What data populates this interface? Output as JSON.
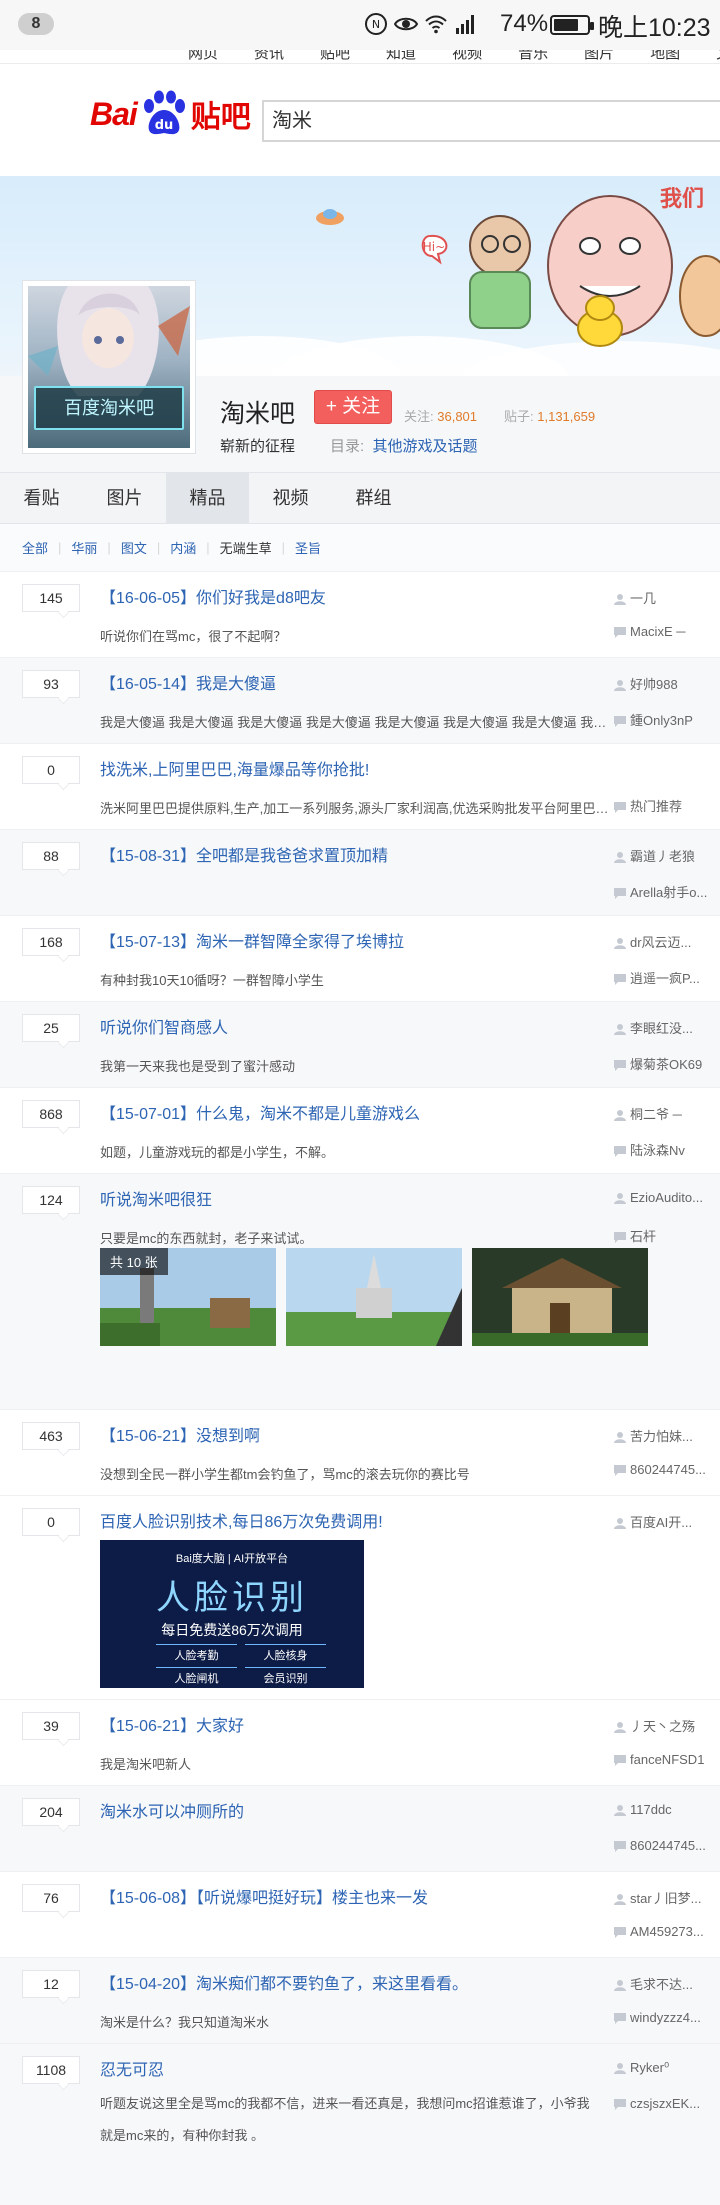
{
  "status_bar": {
    "notification_count": "8",
    "battery_pct": "74%",
    "battery_level": 0.74,
    "time": "晚上10:23",
    "icons": [
      "nfc-icon",
      "eye-icon",
      "wifi-icon",
      "signal-4g-icon",
      "battery-icon"
    ]
  },
  "top_nav": {
    "items": [
      "网页",
      "资讯",
      "贴吧",
      "知道",
      "视频",
      "音乐",
      "图片",
      "地图",
      "文库"
    ]
  },
  "header": {
    "logo_bai": "Bai",
    "logo_du": "du",
    "logo_tieba": "贴吧",
    "search_value": "淘米"
  },
  "forum": {
    "avatar_text": "百度淘米吧",
    "name": "淘米吧",
    "follow_label": "+ 关注",
    "follow_count_label": "关注:",
    "follow_count": "36,801",
    "post_count_label": "贴子:",
    "post_count": "1,131,659",
    "slogan": "崭新的征程",
    "catalog_label": "目录:",
    "catalog_link": "其他游戏及话题"
  },
  "tabs": [
    {
      "label": "看贴"
    },
    {
      "label": "图片"
    },
    {
      "label": "精品"
    },
    {
      "label": "视频"
    },
    {
      "label": "群组"
    }
  ],
  "filters": [
    {
      "label": "全部"
    },
    {
      "label": "华丽"
    },
    {
      "label": "图文"
    },
    {
      "label": "内涵"
    },
    {
      "label": "无端生草"
    },
    {
      "label": "圣旨"
    }
  ],
  "threads": [
    {
      "replies": "145",
      "title": "【16-06-05】你们好我是d8吧友",
      "abstract": "听说你们在骂mc，很了不起啊？",
      "author": "一几",
      "last_reply": "MacixE ─"
    },
    {
      "replies": "93",
      "title": "【16-05-14】我是大傻逼",
      "abstract": "我是大傻逼 我是大傻逼 我是大傻逼 我是大傻逼 我是大傻逼 我是大傻逼 我是大傻逼 我是大傻逼 我是大傻逼 我是大傻逼",
      "author": "好帅988",
      "last_reply": "鍾Only3nP"
    },
    {
      "replies": "0",
      "title": "找洗米,上阿里巴巴,海量爆品等你抢批!",
      "abstract": "洗米阿里巴巴提供原料,生产,加工一系列服务,源头厂家利润高,优选采购批发平台阿里巴巴,一站式采购",
      "author": "",
      "last_reply": "热门推荐"
    },
    {
      "replies": "88",
      "title": "【15-08-31】全吧都是我爸爸求置顶加精",
      "abstract": "",
      "author": "霸道丿老狼",
      "last_reply": "Arella射手o..."
    },
    {
      "replies": "168",
      "title": "【15-07-13】淘米一群智障全家得了埃博拉",
      "abstract": "有种封我10天10循呀？一群智障小学生",
      "author": "dr风云迈...",
      "last_reply": "逍遥一疯P..."
    },
    {
      "replies": "25",
      "title": "听说你们智商感人",
      "abstract": "我第一天来我也是受到了蜜汁感动",
      "author": "李眼红没...",
      "last_reply": "爆菊茶OK69"
    },
    {
      "replies": "868",
      "title": "【15-07-01】什么鬼，淘米不都是儿童游戏么",
      "abstract": "如题，儿童游戏玩的都是小学生，不解。",
      "author": "桐二爷 ─",
      "last_reply": "陆泳森Nv"
    },
    {
      "replies": "124",
      "title": "听说淘米吧很狂",
      "abstract": "只要是mc的东西就封，老子来试试。",
      "author": "EzioAudito...",
      "last_reply": "石杆",
      "image_count": "共 10 张"
    },
    {
      "replies": "463",
      "title": "【15-06-21】没想到啊",
      "abstract": "没想到全民一群小学生都tm会钓鱼了，骂mc的滚去玩你的赛比号",
      "author": "苦力怕妹...",
      "last_reply": "860244745..."
    },
    {
      "replies": "0",
      "title": "百度人脸识别技术,每日86万次免费调用!",
      "abstract": "",
      "author": "百度AI开...",
      "last_reply": ""
    },
    {
      "replies": "39",
      "title": "【15-06-21】大家好",
      "abstract": "我是淘米吧新人",
      "author": "丿天丶之殇",
      "last_reply": "fanceNFSD1"
    },
    {
      "replies": "204",
      "title": "淘米水可以冲厕所的",
      "abstract": "",
      "author": "117ddc",
      "last_reply": "860244745..."
    },
    {
      "replies": "76",
      "title": "【15-06-08】【听说爆吧挺好玩】楼主也来一发",
      "abstract": "",
      "author": "star丿旧梦...",
      "last_reply": "AM459273..."
    },
    {
      "replies": "12",
      "title": "【15-04-20】淘米痴们都不要钓鱼了，来这里看看。",
      "abstract": "淘米是什么？我只知道淘米水",
      "author": "毛求不达...",
      "last_reply": "windyzzz4..."
    },
    {
      "replies": "1108",
      "title": "忍无可忍",
      "abstract": "听题友说这里全是骂mc的我都不信，进来一看还真是，我想问mc招谁惹谁了，小爷我就是mc来的，有种你封我 。",
      "author": "Ryker⁰",
      "last_reply": "czsjszxEK..."
    }
  ],
  "ad": {
    "brand": "Bai度大脑 | AI开放平台",
    "title": "人脸识别",
    "subtitle": "每日免费送86万次调用",
    "features": [
      "人脸考勤",
      "人脸核身",
      "人脸闸机",
      "会员识别"
    ]
  },
  "colors": {
    "link_blue": "#2d64b3",
    "follow_red": "#f25f5c",
    "stat_orange": "#e17b2a",
    "brand_red": "#e10602",
    "logo_blue": "#2932e1"
  }
}
